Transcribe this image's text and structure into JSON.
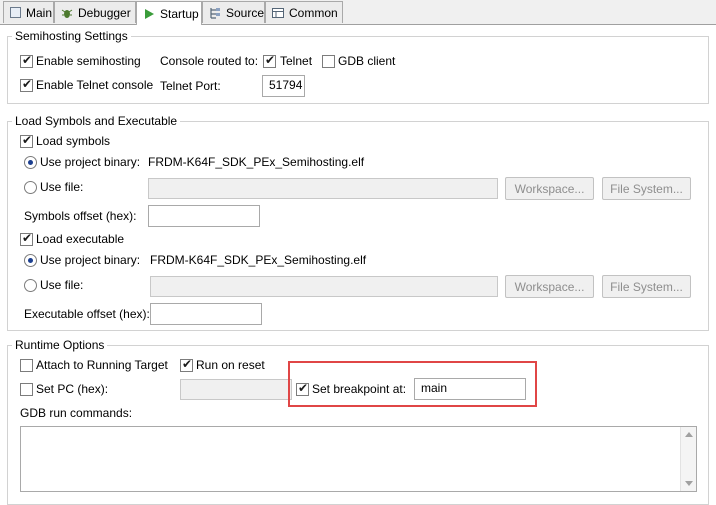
{
  "tabs": [
    {
      "label": "Main",
      "icon": "main-tab-icon"
    },
    {
      "label": "Debugger",
      "icon": "debugger-bug-icon"
    },
    {
      "label": "Startup",
      "icon": "play-icon"
    },
    {
      "label": "Source",
      "icon": "source-icon"
    },
    {
      "label": "Common",
      "icon": "common-icon"
    }
  ],
  "active_tab": "Startup",
  "semihosting": {
    "title": "Semihosting Settings",
    "enable_semihosting": "Enable semihosting",
    "enable_telnet_console": "Enable Telnet console",
    "console_routed_to": "Console routed to:",
    "telnet": "Telnet",
    "gdb_client": "GDB client",
    "telnet_port_label": "Telnet Port:",
    "telnet_port_value": "51794"
  },
  "load": {
    "title": "Load Symbols and Executable",
    "load_symbols": "Load symbols",
    "use_project_binary": "Use project binary:",
    "symbols_binary": "FRDM-K64F_SDK_PEx_Semihosting.elf",
    "use_file": "Use file:",
    "workspace_button": "Workspace...",
    "filesystem_button": "File System...",
    "symbols_offset": "Symbols offset (hex):",
    "load_executable": "Load executable",
    "executable_binary": "FRDM-K64F_SDK_PEx_Semihosting.elf",
    "executable_offset": "Executable offset (hex):"
  },
  "runtime": {
    "title": "Runtime Options",
    "attach": "Attach to Running Target",
    "run_on_reset": "Run on reset",
    "set_pc": "Set PC (hex):",
    "set_breakpoint": "Set breakpoint at:",
    "breakpoint_value": "main",
    "gdb_run_commands": "GDB run commands:"
  },
  "colors": {
    "highlight": "#e04646",
    "accent": "#1c3f8f"
  }
}
